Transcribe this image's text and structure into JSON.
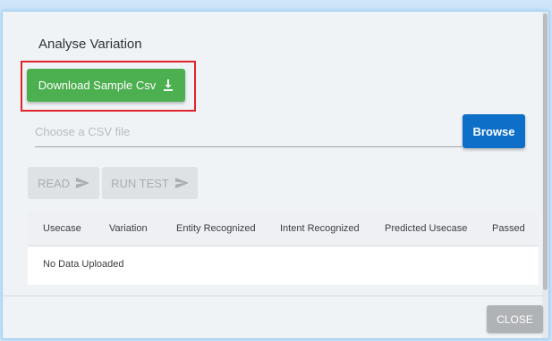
{
  "dialog": {
    "title": "Analyse Variation"
  },
  "download": {
    "label": "Download Sample Csv",
    "icon": "download-icon"
  },
  "file_input": {
    "placeholder": "Choose a CSV file",
    "value": ""
  },
  "browse": {
    "label": "Browse"
  },
  "actions": {
    "read_label": "READ",
    "run_test_label": "RUN TEST",
    "icon": "send-icon"
  },
  "table": {
    "columns": [
      "Usecase",
      "Variation",
      "Entity Recognized",
      "Intent Recognized",
      "Predicted Usecase",
      "Passed"
    ],
    "empty_message": "No Data Uploaded"
  },
  "footer": {
    "close_label": "CLOSE"
  },
  "colors": {
    "download_button": "#4caf50",
    "browse_button": "#0d6fc7",
    "highlight_border": "#e0242a",
    "close_button": "#b0b3b6"
  }
}
